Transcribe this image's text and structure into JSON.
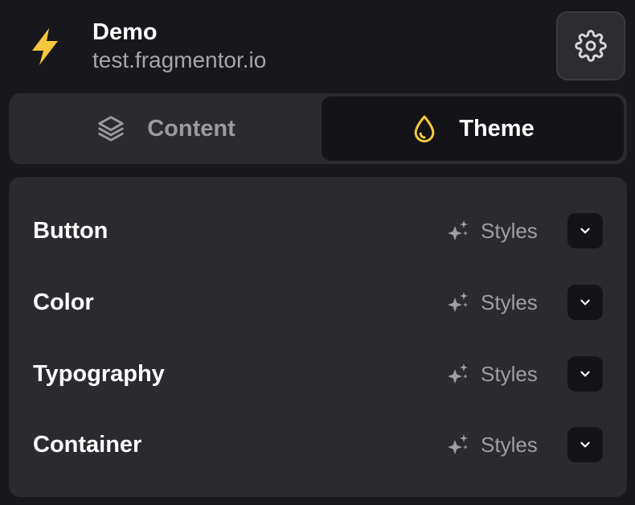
{
  "header": {
    "project_name": "Demo",
    "project_domain": "test.fragmentor.io",
    "logo_icon": "lightning-bolt-icon",
    "settings_icon": "gear-icon"
  },
  "tabs": [
    {
      "label": "Content",
      "icon": "layers-icon",
      "active": false
    },
    {
      "label": "Theme",
      "icon": "droplet-icon",
      "active": true
    }
  ],
  "sections": [
    {
      "label": "Button",
      "action_label": "Styles"
    },
    {
      "label": "Color",
      "action_label": "Styles"
    },
    {
      "label": "Typography",
      "action_label": "Styles"
    },
    {
      "label": "Container",
      "action_label": "Styles"
    }
  ],
  "colors": {
    "background": "#18181c",
    "surface": "#2a2a2f",
    "active_tab": "#141418",
    "accent_yellow": "#f5c93b",
    "muted_text": "#9e9ea5"
  }
}
